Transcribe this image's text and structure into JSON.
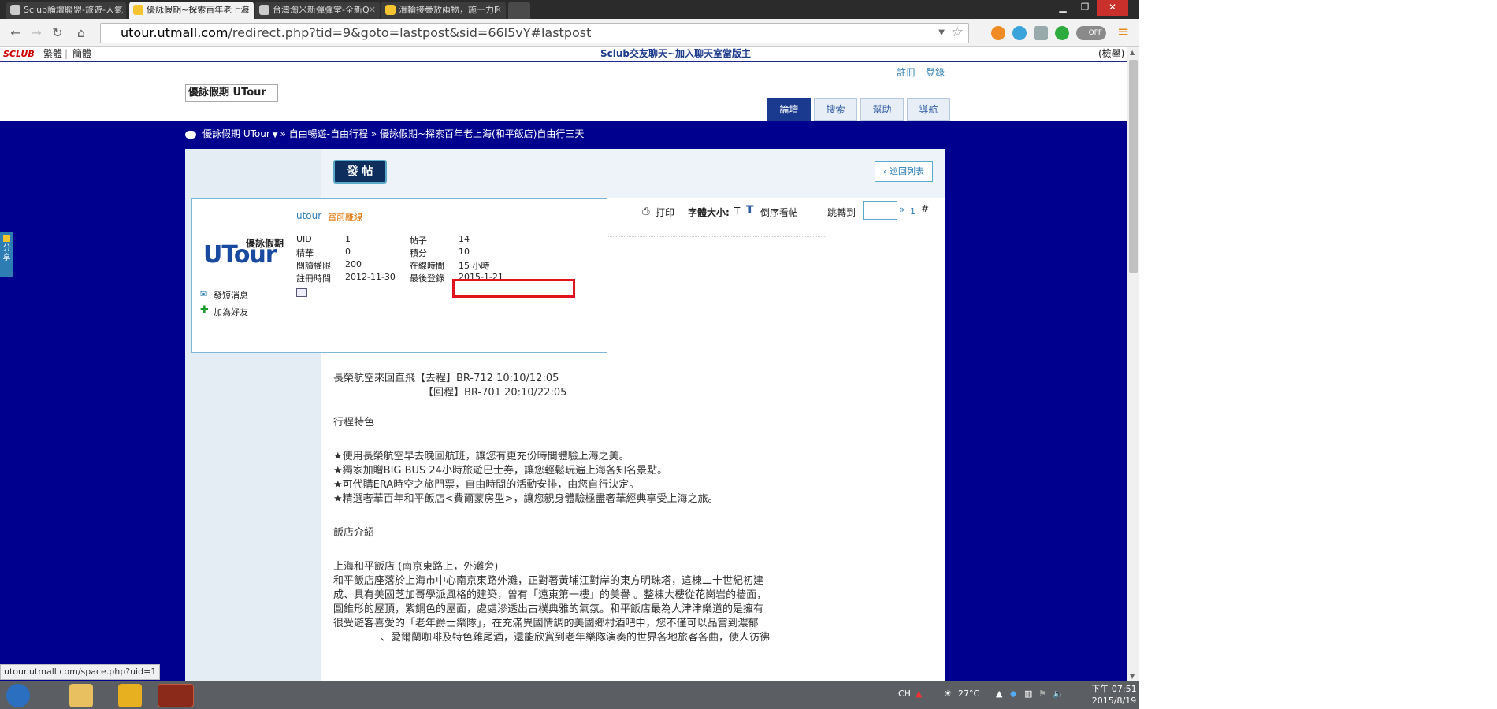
{
  "tabs": [
    {
      "title": "Sclub論壇聯盟-旅遊-人氣",
      "active": false
    },
    {
      "title": "優詠假期~探索百年老上海",
      "active": true
    },
    {
      "title": "台灣淘米新彈彈堂-全新Q",
      "active": false
    },
    {
      "title": "滑輪接疊放兩物，施一力F",
      "active": false
    }
  ],
  "url": {
    "host": "utour.utmall.com",
    "path": "/redirect.php?tid=9&goto=lastpost&sid=66l5vY#lastpost"
  },
  "extensions": {
    "toggle_label": "OFF"
  },
  "sclubbar": {
    "logo": "SCLUB",
    "trad": "繁體",
    "simp": "簡體",
    "center": "Sclub交友聊天~加入聊天室當版主",
    "right": "(檢舉)"
  },
  "header": {
    "register": "註冊",
    "login": "登錄",
    "logo_alt": "優詠假期 UTour",
    "nav": [
      {
        "label": "論壇",
        "active": true
      },
      {
        "label": "搜索",
        "active": false
      },
      {
        "label": "幫助",
        "active": false
      },
      {
        "label": "導航",
        "active": false
      }
    ]
  },
  "breadcrumb": {
    "home": "優詠假期 UTour",
    "sep": "»",
    "forum": "自由暢遊-自由行程",
    "thread": "優詠假期~探索百年老上海(和平飯店)自由行三天"
  },
  "toolbar": {
    "post_button": "發 帖",
    "back_button": "巡回列表",
    "print": "打印",
    "font_size_label": "字體大小:",
    "font_size_value": "T",
    "reverse": "倒序看帖",
    "jump_label": "跳轉到",
    "jump_arrow": "»",
    "page": "1",
    "hash": "#"
  },
  "profile": {
    "username": "utour",
    "status": "當前離線",
    "logo_text_top": "優詠假期",
    "logo_text_big": "UTour",
    "fields": [
      {
        "label": "UID",
        "value": "1"
      },
      {
        "label": "帖子",
        "value": "14"
      },
      {
        "label": "精華",
        "value": "0"
      },
      {
        "label": "積分",
        "value": "10"
      },
      {
        "label": "閱讀權限",
        "value": "200"
      },
      {
        "label": "在線時間",
        "value": "15 小時"
      },
      {
        "label": "註冊時間",
        "value": "2012-11-30"
      },
      {
        "label": "最後登錄",
        "value": "2015-1-21"
      }
    ],
    "send_message": "發短消息",
    "add_friend": "加為好友"
  },
  "post": {
    "lines": [
      "長榮航空來回直飛【去程】BR-712  10:10/12:05",
      "【回程】BR-701  20:10/22:05",
      "行程特色",
      "★使用長榮航空早去晚回航班，讓您有更充份時間體驗上海之美。",
      "★獨家加贈BIG BUS 24小時旅遊巴士券，讓您輕鬆玩遍上海各知名景點。",
      "★可代購ERA時空之旅門票，自由時間的活動安排，由您自行決定。",
      "★精選奢華百年和平飯店<費爾蒙房型>，讓您親身體驗極盡奢華經典享受上海之旅。",
      "飯店介紹",
      "上海和平飯店 (南京東路上，外灘旁)",
      "和平飯店座落於上海市中心南京東路外灘，正對著黃埔江對岸的東方明珠塔，這棟二十世紀初建",
      "成、具有美國芝加哥學派風格的建築，曾有「遠東第一樓」的美譽 。整棟大樓從花崗岩的牆面，",
      "圓錐形的屋頂，紫銅色的屋面，處處滲透出古樸典雅的氣氛。和平飯店最為人津津樂道的是擁有",
      "很受遊客喜愛的「老年爵士樂隊」，在充滿異國情調的美國鄉村酒吧中，您不僅可以品嘗到濃郁",
      "、愛爾蘭咖啡及特色雞尾酒，還能欣賞到老年樂隊演奏的世界各地旅客各曲，使人彷彿"
    ]
  },
  "share": "分享",
  "status_url": "utour.utmall.com/space.php?uid=1",
  "taskbar": {
    "lang": "CH",
    "temp": "27°C",
    "time": "下午 07:51",
    "date": "2015/8/19"
  }
}
